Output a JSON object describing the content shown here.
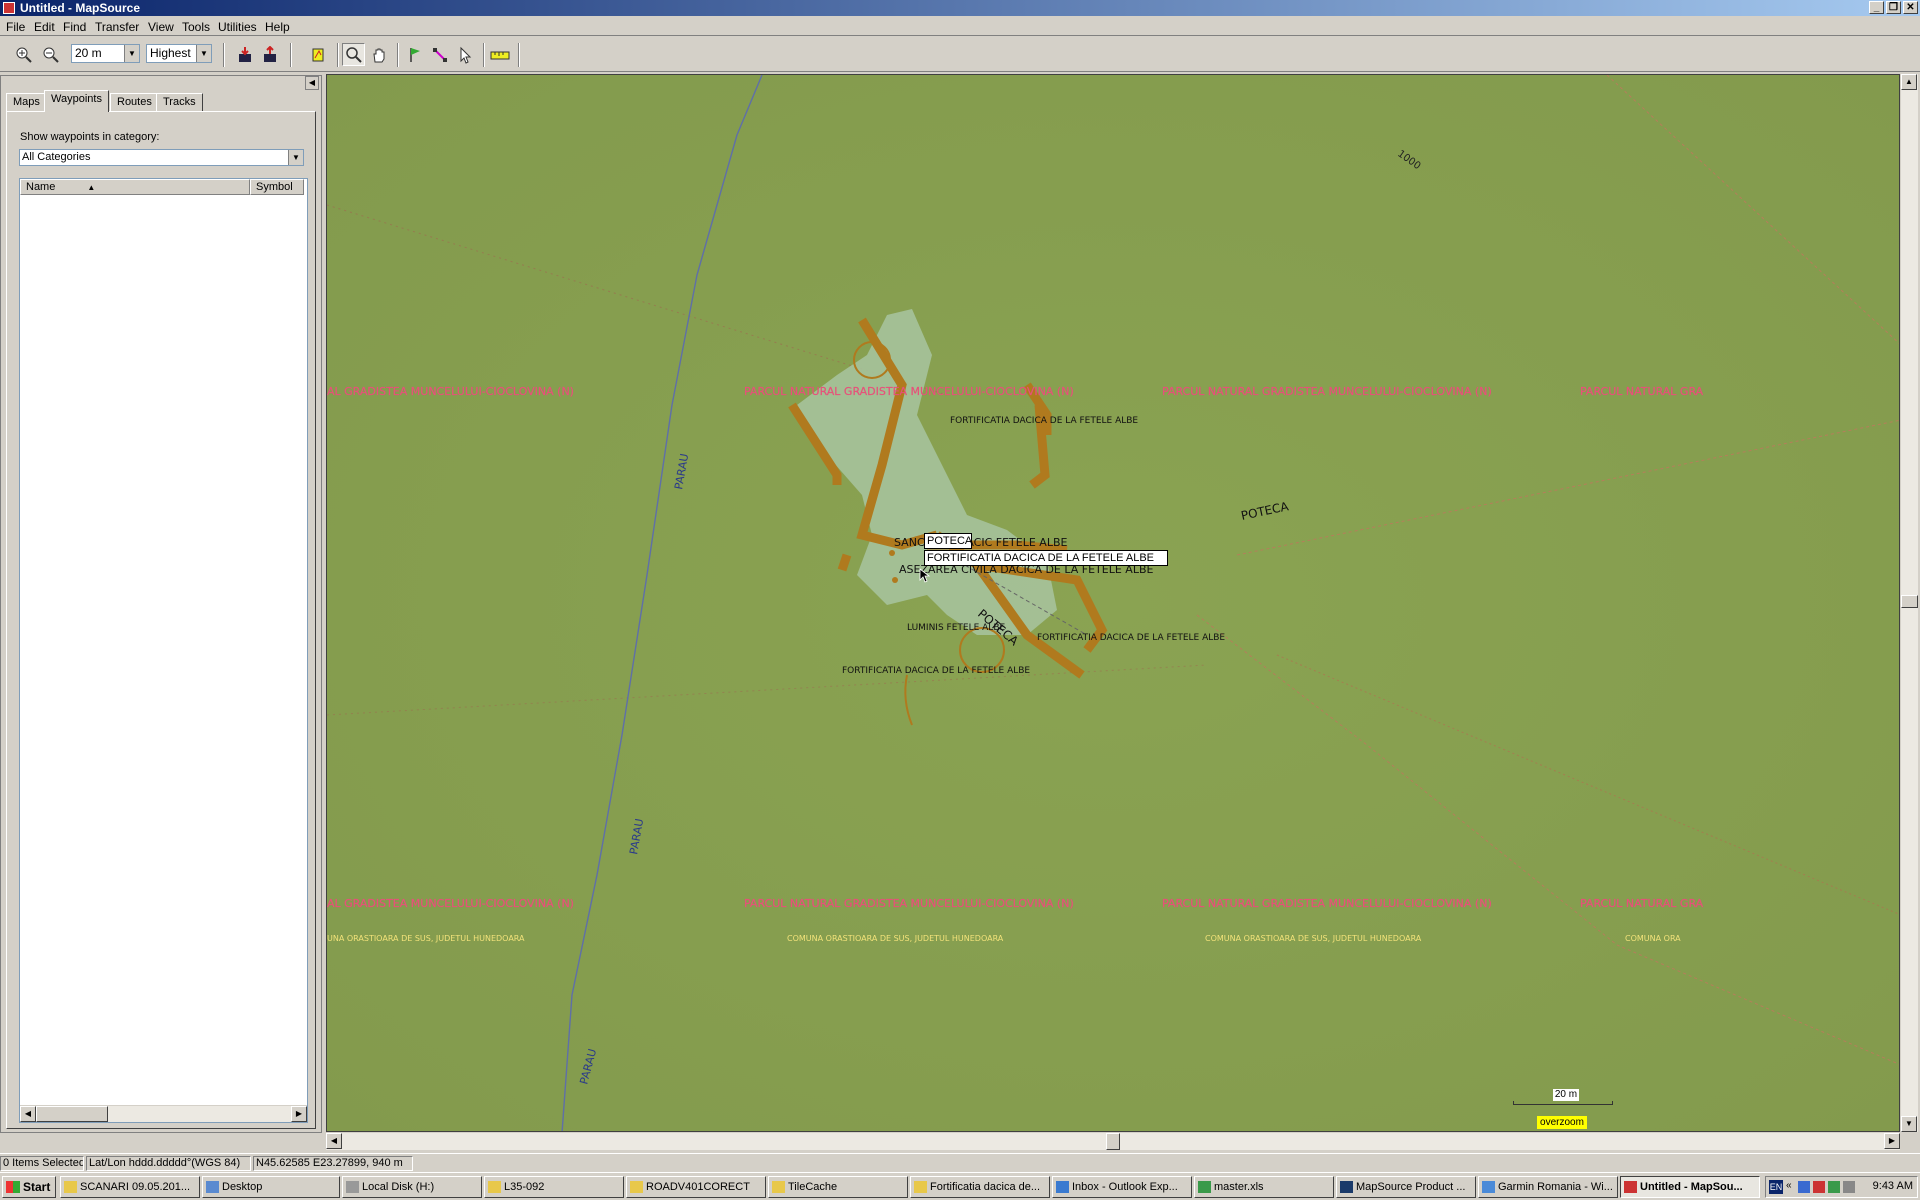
{
  "window": {
    "title": "Untitled - MapSource"
  },
  "menu": [
    "File",
    "Edit",
    "Find",
    "Transfer",
    "View",
    "Tools",
    "Utilities",
    "Help"
  ],
  "toolbar": {
    "zoom_value": "20 m",
    "detail_value": "Highest"
  },
  "left_panel": {
    "tabs": [
      "Maps",
      "Waypoints",
      "Routes",
      "Tracks"
    ],
    "active_tab": "Waypoints",
    "category_label": "Show waypoints in category:",
    "category_value": "All Categories",
    "columns": [
      "Name",
      "Symbol"
    ]
  },
  "map": {
    "park_label": "PARCUL NATURAL GRADISTEA MUNCELULUI-CIOCLOVINA (N)",
    "park_label_partial_left": "AL GRADISTEA MUNCELULUI-CIOCLOVINA (N)",
    "park_label_partial_right": "PARCUL NATURAL GRA",
    "commune_label": "COMUNA ORASTIOARA DE SUS, JUDETUL HUNEDOARA",
    "commune_label_partial_left": "UNA ORASTIOARA DE SUS, JUDETUL HUNEDOARA",
    "commune_label_partial_right": "COMUNA ORA",
    "contour_label": "1000",
    "stream_label": "PARAU",
    "trail_label": "POTECA",
    "fort_label": "FORTIFICATIA DACICA DE LA FETELE ALBE",
    "sanctuary_label": "SANCTUAR DACIC FETELE ALBE",
    "settlement_label": "ASEZAREA CIVILA DACICA DE LA FETELE ALBE",
    "clearing_label": "LUMINIS FETELE ALBE",
    "tooltip_line1": "POTECA",
    "tooltip_line2": "FORTIFICATIA DACICA DE LA FETELE ALBE",
    "scale_label": "20 m",
    "overzoom_label": "overzoom",
    "colors": {
      "terrain": "#8aa352",
      "fort": "#b07a1e",
      "park_text": "#e8507a",
      "clearing": "#a8c4a0"
    }
  },
  "status": {
    "selected": "0 Items Selected",
    "format": "Lat/Lon hddd.ddddd°(WGS 84)",
    "position": "N45.62585 E23.27899, 940 m"
  },
  "taskbar": {
    "start": "Start",
    "items": [
      "SCANARI 09.05.201...",
      "Desktop",
      "Local Disk (H:)",
      "L35-092",
      "ROADV401CORECT",
      "TileCache",
      "Fortificatia dacica de...",
      "Inbox - Outlook Exp...",
      "master.xls",
      "MapSource Product ...",
      "Garmin Romania - Wi...",
      "Untitled - MapSou..."
    ],
    "lang": "EN",
    "clock": "9:43 AM"
  }
}
